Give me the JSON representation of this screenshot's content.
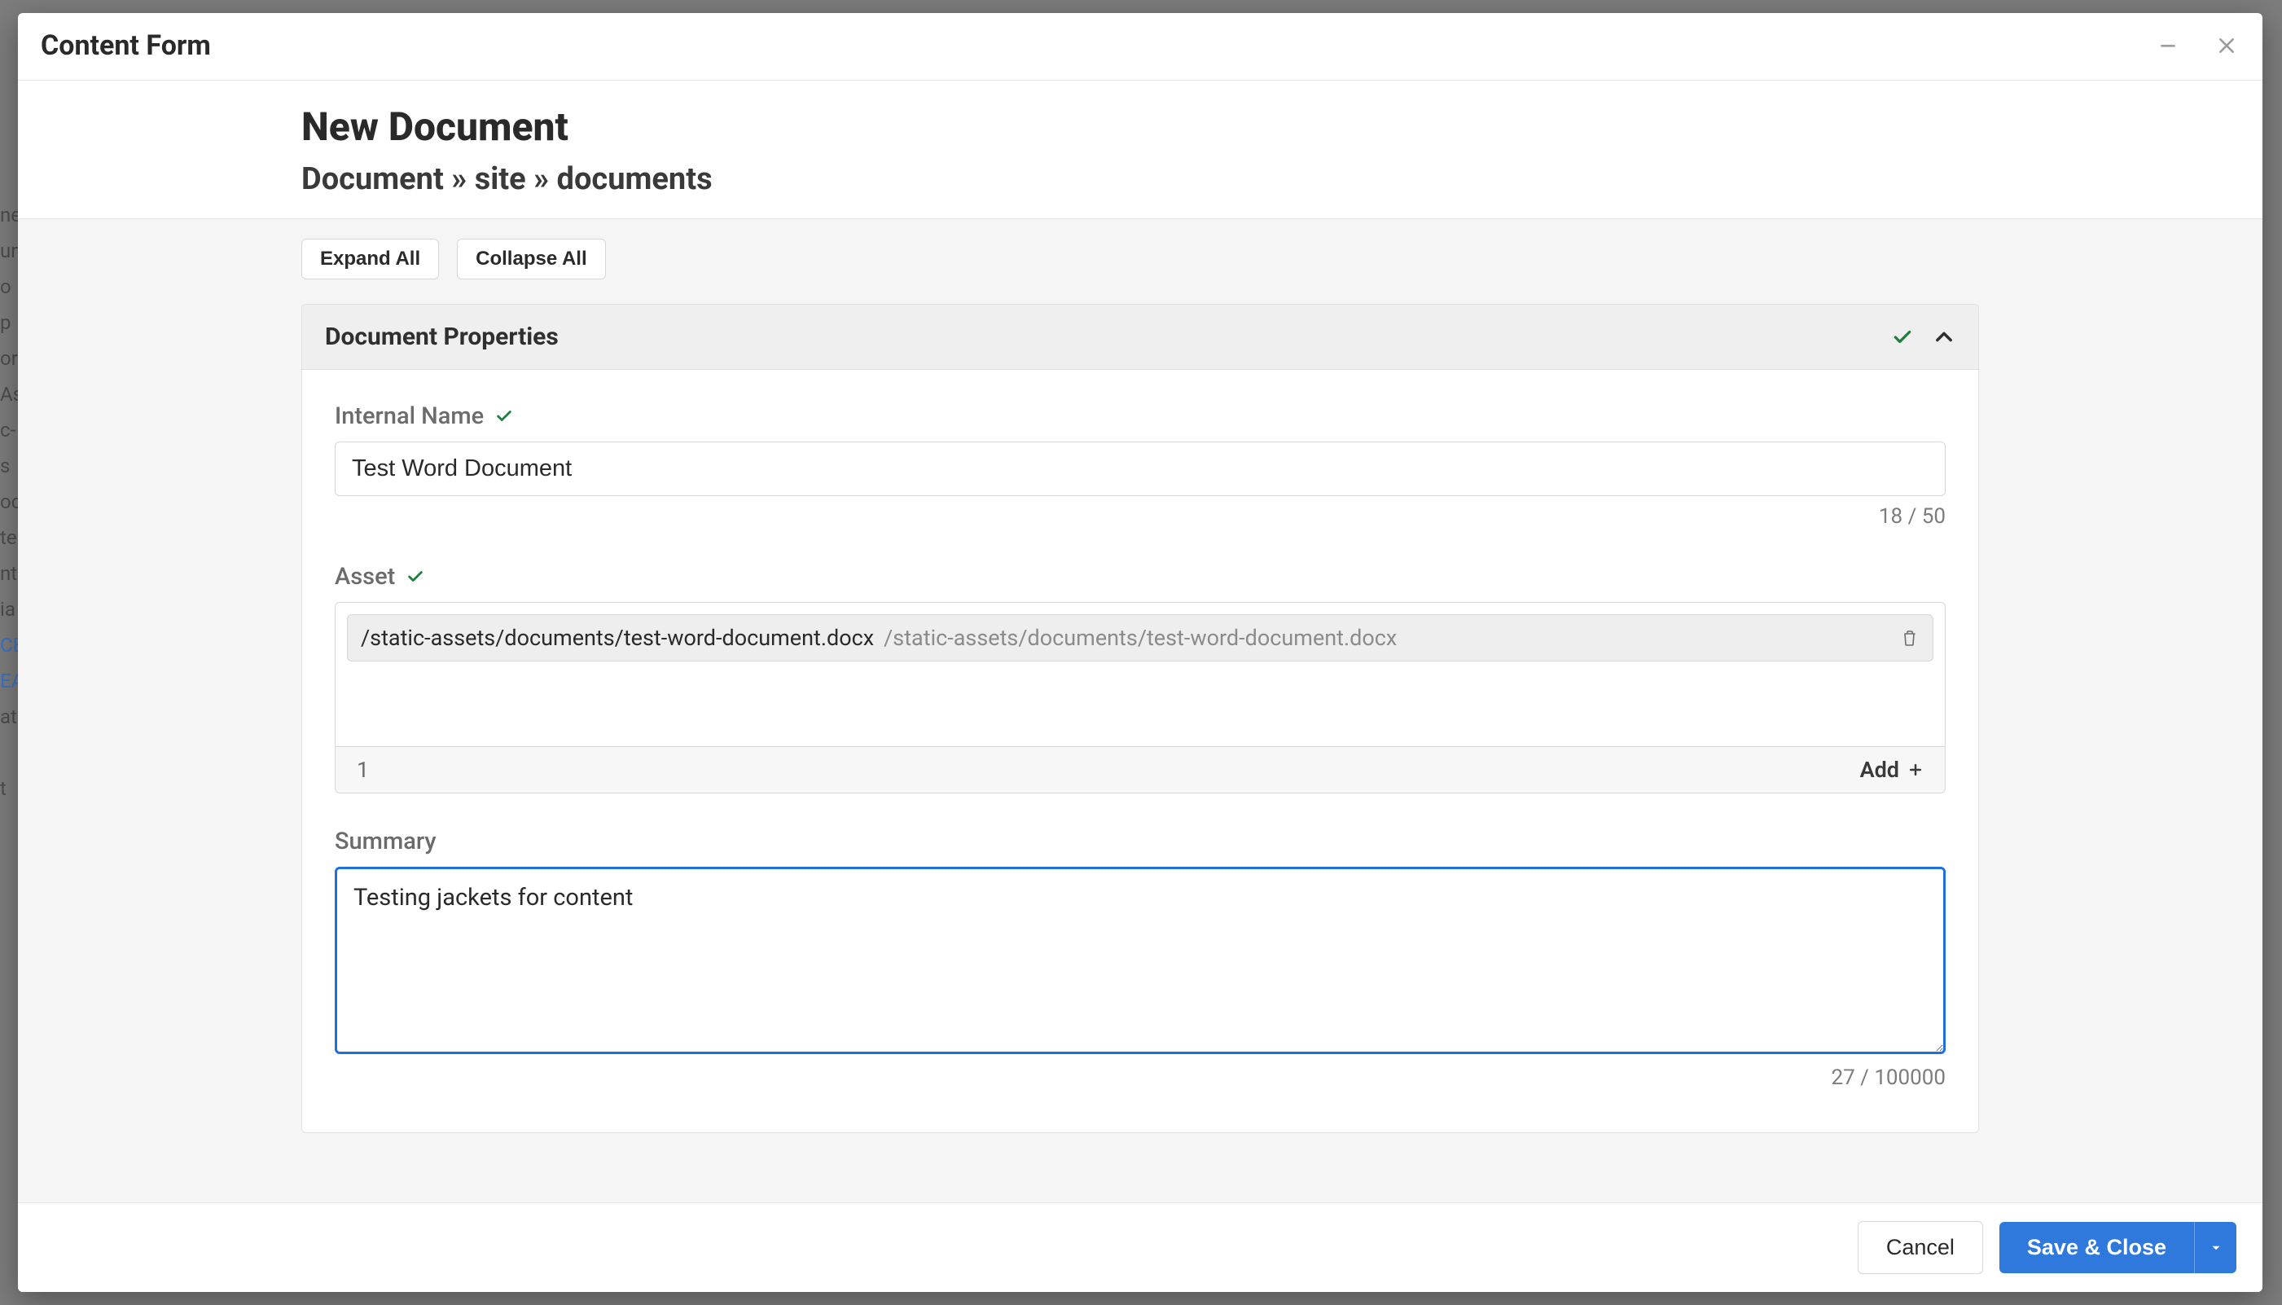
{
  "modal": {
    "title": "Content Form"
  },
  "page": {
    "title": "New Document",
    "breadcrumb": "Document » site » documents"
  },
  "buttons": {
    "expand_all": "Expand All",
    "collapse_all": "Collapse All",
    "cancel": "Cancel",
    "save_close": "Save & Close"
  },
  "section": {
    "title": "Document Properties"
  },
  "fields": {
    "internal_name": {
      "label": "Internal Name",
      "value": "Test Word Document",
      "counter": "18 / 50"
    },
    "asset": {
      "label": "Asset",
      "item_name": "/static-assets/documents/test-word-document.docx",
      "item_path": "/static-assets/documents/test-word-document.docx",
      "count": "1",
      "add_label": "Add"
    },
    "summary": {
      "label": "Summary",
      "value": "Testing jackets for content",
      "counter": "27 / 100000"
    }
  }
}
